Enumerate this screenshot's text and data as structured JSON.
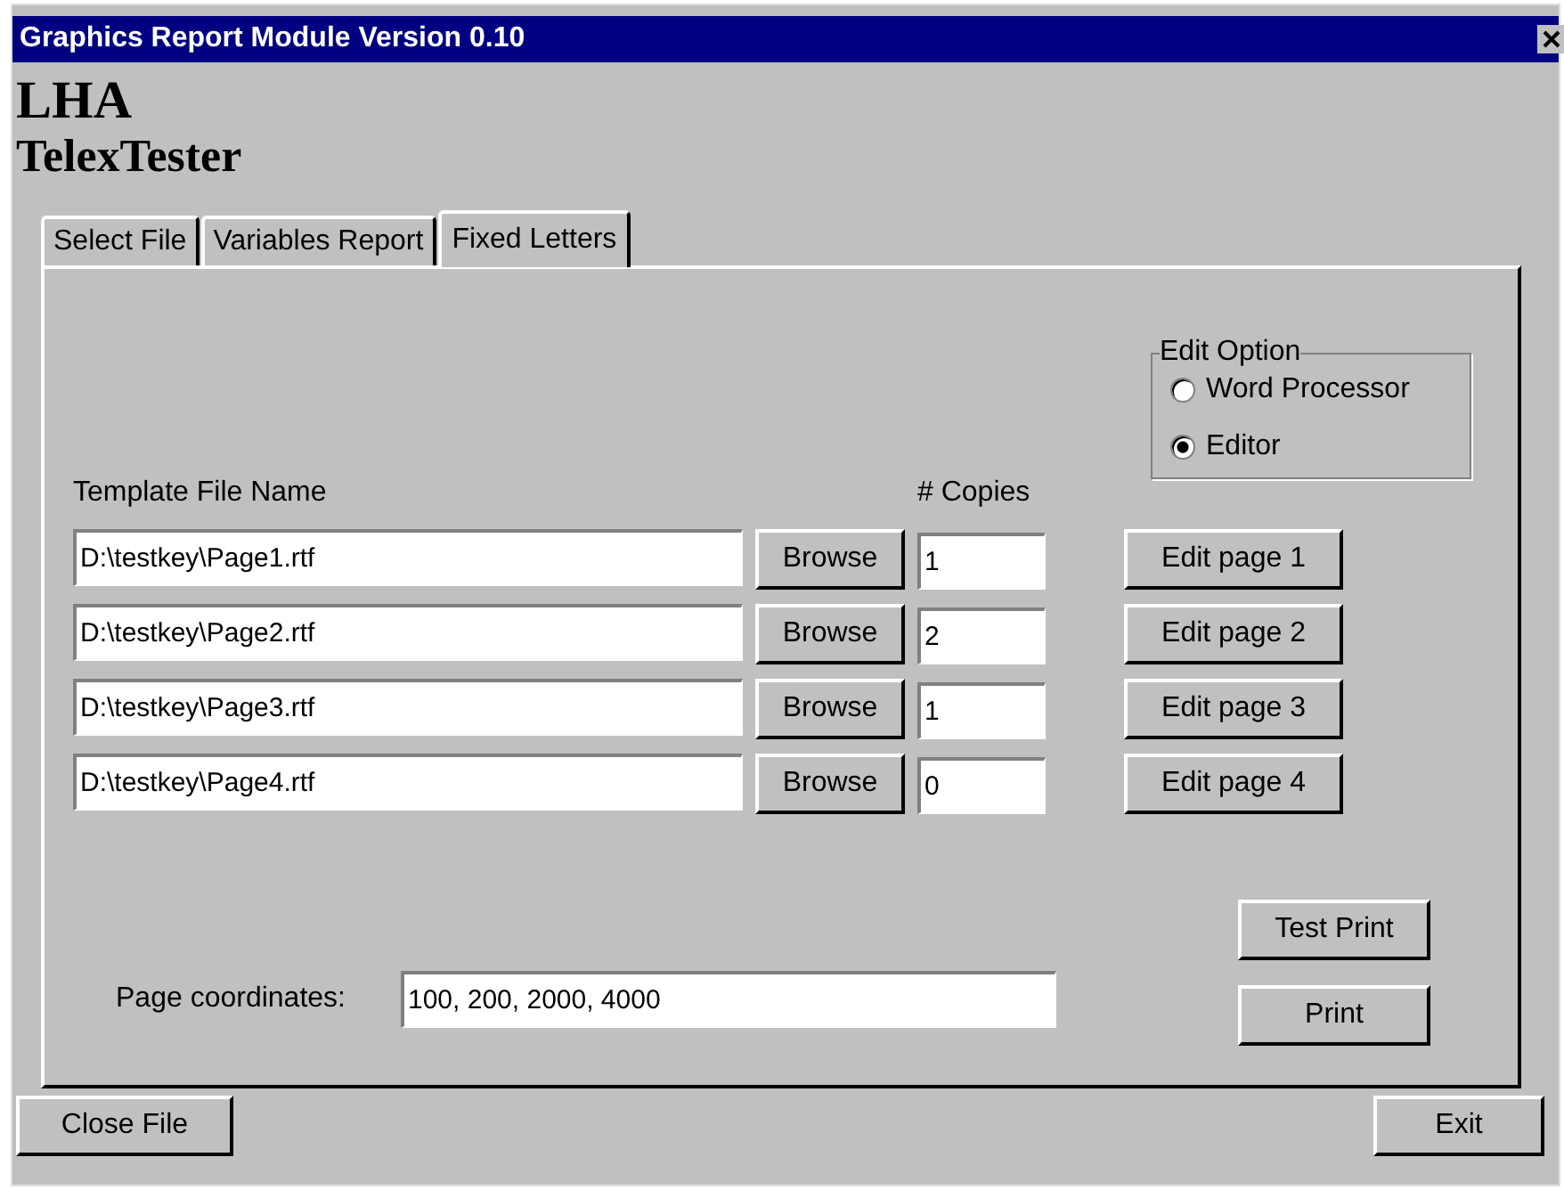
{
  "window": {
    "title": "Graphics Report Module Version 0.10"
  },
  "header": {
    "app": "LHA",
    "subtitle": "TelexTester"
  },
  "tabs": [
    {
      "label": "Select File",
      "selected": false
    },
    {
      "label": "Variables Report",
      "selected": false
    },
    {
      "label": "Fixed Letters",
      "selected": true
    }
  ],
  "edit_option": {
    "title": "Edit Option",
    "options": [
      {
        "label": "Word Processor",
        "selected": false
      },
      {
        "label": "Editor",
        "selected": true
      }
    ]
  },
  "columns": [
    "Template File Name",
    "# Copies"
  ],
  "rows": [
    {
      "file": "D:\\testkey\\Page1.rtf",
      "browse": "Browse",
      "copies": "1",
      "edit": "Edit page 1"
    },
    {
      "file": "D:\\testkey\\Page2.rtf",
      "browse": "Browse",
      "copies": "2",
      "edit": "Edit page 2"
    },
    {
      "file": "D:\\testkey\\Page3.rtf",
      "browse": "Browse",
      "copies": "1",
      "edit": "Edit page 3"
    },
    {
      "file": "D:\\testkey\\Page4.rtf",
      "browse": "Browse",
      "copies": "0",
      "edit": "Edit page 4"
    }
  ],
  "coordinates": {
    "label": "Page coordinates:",
    "value": "100, 200, 2000, 4000"
  },
  "print_buttons": [
    "Test Print",
    "Print"
  ],
  "footer": {
    "close": "Close File",
    "exit": "Exit"
  }
}
